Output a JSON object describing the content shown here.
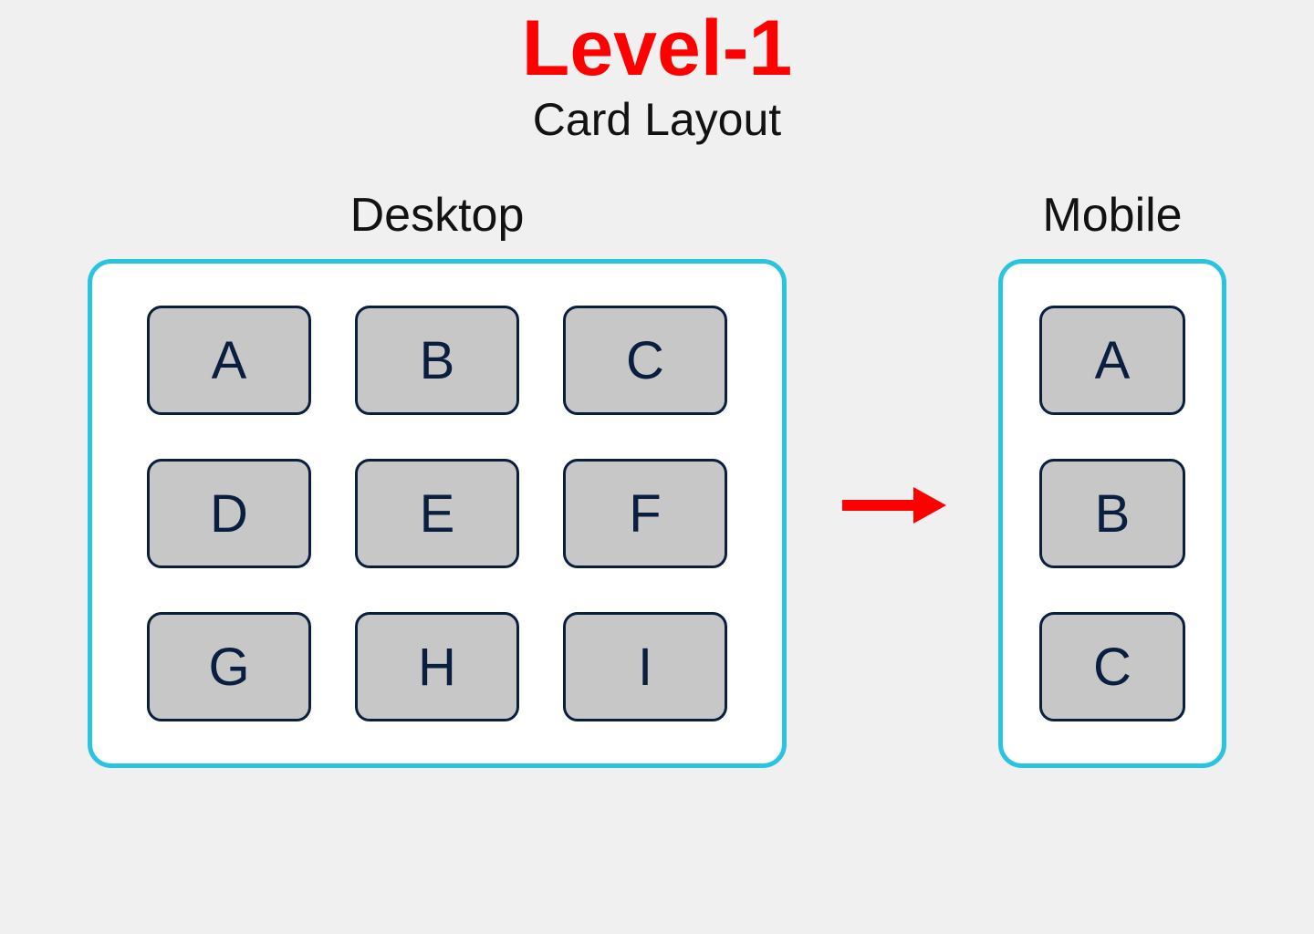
{
  "heading": {
    "level_title": "Level-1",
    "subtitle": "Card Layout"
  },
  "columns": {
    "desktop_label": "Desktop",
    "mobile_label": "Mobile"
  },
  "desktop_cards": [
    "A",
    "B",
    "C",
    "D",
    "E",
    "F",
    "G",
    "H",
    "I"
  ],
  "mobile_cards": [
    "A",
    "B",
    "C"
  ],
  "colors": {
    "accent_red": "#ff0000",
    "frame_border": "#29c4e0",
    "card_fill": "#c7c7c7",
    "card_border": "#0a1e3f"
  }
}
